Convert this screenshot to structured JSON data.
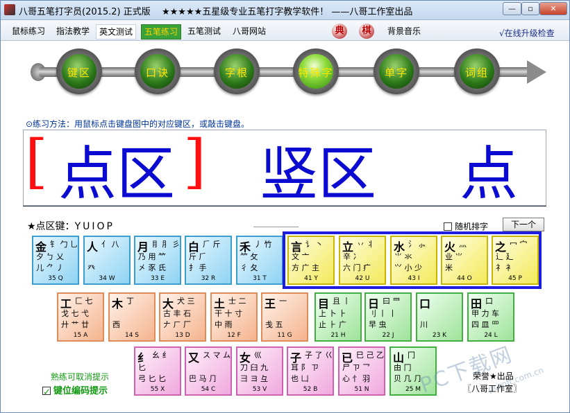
{
  "window": {
    "title": "八哥五笔打字员(2015.2) 正式版",
    "slogan": "★★★★★五星级专业五笔打字教学软件！ ——八哥工作室出品",
    "min": "—",
    "max": "▫",
    "close": "✕"
  },
  "menu": {
    "tabs": [
      "鼠标练习",
      "指法教学",
      "英文测试",
      "五笔练习",
      "五笔测试",
      "八哥网站"
    ],
    "dian": "典",
    "qi": "棋",
    "music": "背景音乐",
    "upgrade": "√在线升级检查"
  },
  "stages": [
    "键区",
    "口诀",
    "字根",
    "特殊字",
    "单字",
    "词组"
  ],
  "instruction": "⊙练习方法：用鼠标点击键盘图中的对应键区，或敲击键盘。",
  "display": {
    "open": "[",
    "word1": "点区",
    "close": "]",
    "word2": "竖区",
    "word3": "点"
  },
  "keyrow": {
    "prefix": "★点区键：",
    "keys": "YUIOP"
  },
  "random_label": "随机排字",
  "next_label": "下一个",
  "keys": [
    {
      "main": "金",
      "comp": "钅 勹 乚",
      "comp2": "夕 ㄅ 乂",
      "comp3": "儿 ⺈ 丿",
      "code": "35 Q",
      "color": "blue"
    },
    {
      "main": "人",
      "comp": "亻   八",
      "comp2": "",
      "comp3": "   癶",
      "code": "34 W",
      "color": "blue"
    },
    {
      "main": "月",
      "comp": "⺝ ⺼ 彡",
      "comp2": "乃 用 ⺮",
      "comp3": "㐅 豕 氏",
      "code": "33 E",
      "color": "blue"
    },
    {
      "main": "白",
      "comp": "⺁ 斤",
      "comp2": "斤 ⺁",
      "comp3": "扌 手",
      "code": "32 R",
      "color": "blue"
    },
    {
      "main": "禾",
      "comp": "丿 竹",
      "comp2": "⺮ 攵",
      "comp3": "彳 夂",
      "code": "31 T",
      "color": "blue"
    },
    {
      "main": "言",
      "comp": "讠 丶",
      "comp2": "文 亠",
      "comp3": "方 广 主",
      "code": "41 Y",
      "color": "yellow"
    },
    {
      "main": "立",
      "comp": "丷 丬",
      "comp2": "辛 冫",
      "comp3": "六 门 疒",
      "code": "42 U",
      "color": "yellow"
    },
    {
      "main": "水",
      "comp": "氵 ⺗",
      "comp2": "⺌ 氺",
      "comp3": "⺍ 小 少",
      "code": "43 I",
      "color": "yellow"
    },
    {
      "main": "火",
      "comp": "灬",
      "comp2": "业 ⺌",
      "comp3": "米",
      "code": "44 O",
      "color": "yellow"
    },
    {
      "main": "之",
      "comp": "冖 宀",
      "comp2": "辶 廴",
      "comp3": "礻 衤",
      "code": "45 P",
      "color": "yellow"
    },
    {
      "main": "工",
      "comp": "匚 七",
      "comp2": "戈 七 弋",
      "comp3": "廾 艹 廿",
      "code": "15 A",
      "color": "orange"
    },
    {
      "main": "木",
      "comp": "丁",
      "comp2": "",
      "comp3": "西",
      "code": "14 S",
      "color": "orange"
    },
    {
      "main": "大",
      "comp": "犬 三",
      "comp2": "古 丰 石",
      "comp3": "𠂇 ㄏ 厂",
      "code": "13 D",
      "color": "orange"
    },
    {
      "main": "土",
      "comp": "士 二",
      "comp2": "干 十 寸",
      "comp3": "中 雨",
      "code": "12 F",
      "color": "orange"
    },
    {
      "main": "王",
      "comp": "一",
      "comp2": "",
      "comp3": "戋 五",
      "code": "11 G",
      "color": "orange"
    },
    {
      "main": "目",
      "comp": "且 丨",
      "comp2": "上 卜 ⺊",
      "comp3": "止 ⺊ 广",
      "code": "21 H",
      "color": "green"
    },
    {
      "main": "日",
      "comp": "曰 ⺜",
      "comp2": "刂 丨 丨",
      "comp3": "早 虫",
      "code": "22 J",
      "color": "green"
    },
    {
      "main": "口",
      "comp": "",
      "comp2": "",
      "comp3": "川",
      "code": "23 K",
      "color": "green"
    },
    {
      "main": "田",
      "comp": "口",
      "comp2": "甲 力 车",
      "comp3": "四 皿 罒",
      "code": "24 L",
      "color": "green"
    },
    {
      "main": "纟",
      "comp": "幺 纟",
      "comp2": "匕",
      "comp3": "弓 匕 匕",
      "code": "55 X",
      "color": "pink"
    },
    {
      "main": "又",
      "comp": "ス マ ム",
      "comp2": "",
      "comp3": "巴 马 ⺆",
      "code": "54 C",
      "color": "pink"
    },
    {
      "main": "女",
      "comp": "巛",
      "comp2": "刀 臼 九",
      "comp3": "彐 ヨ 彑",
      "code": "53 V",
      "color": "pink"
    },
    {
      "main": "子",
      "comp": "子 了 巜",
      "comp2": "耳 阝 ㄗ",
      "comp3": "也 凵",
      "code": "52 B",
      "color": "pink"
    },
    {
      "main": "已",
      "comp": "巳 己 乙",
      "comp2": "尸 ㄗ 乛",
      "comp3": "心 忄 羽",
      "code": "51 N",
      "color": "pink"
    },
    {
      "main": "山",
      "comp": "冂",
      "comp2": "由 冂",
      "comp3": "贝 几 ⺆",
      "code": "25 M",
      "color": "green"
    }
  ],
  "hint_cancel": "熟练可取消提示",
  "hint_toggle": "键位编码提示",
  "credit1": "荣誉★出品",
  "credit2": "〖八哥工作室〗",
  "watermark": "PC下载网",
  "watermark2": "pcsoft.com.cn"
}
